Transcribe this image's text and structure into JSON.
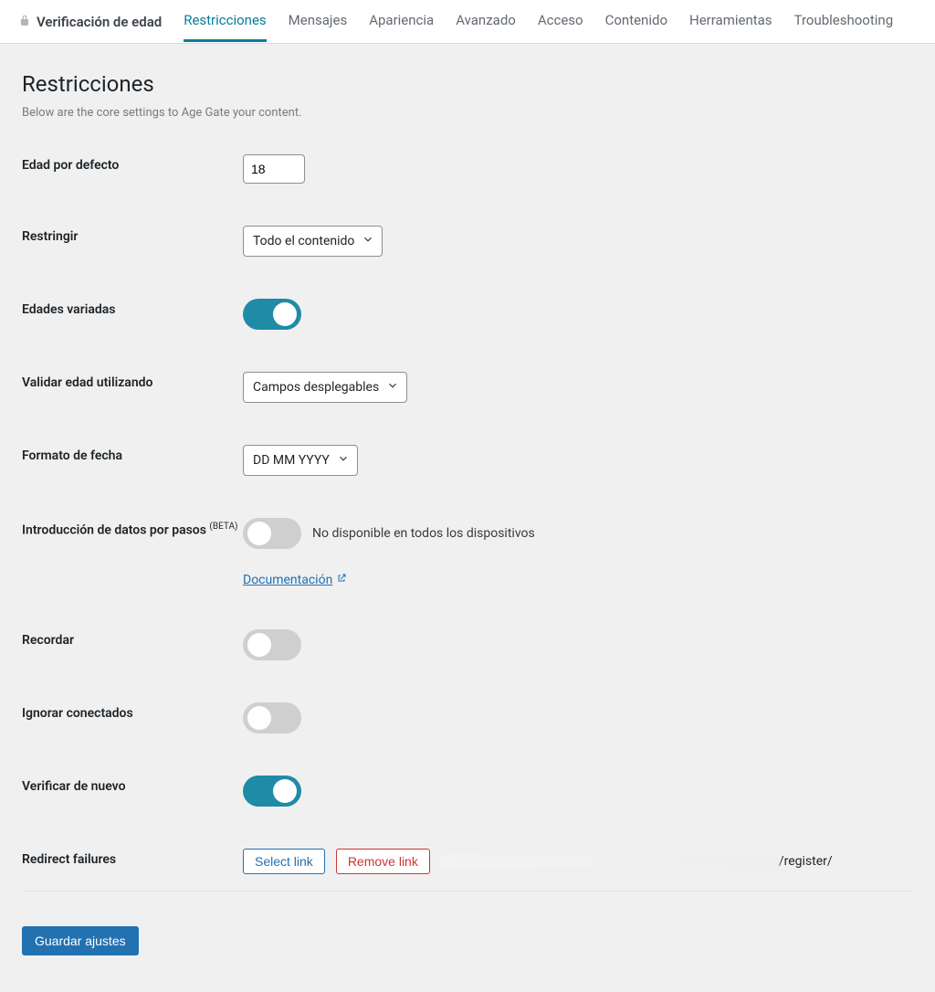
{
  "nav": {
    "title": "Verificación de edad",
    "tabs": [
      {
        "label": "Restricciones",
        "active": true
      },
      {
        "label": "Mensajes"
      },
      {
        "label": "Apariencia"
      },
      {
        "label": "Avanzado"
      },
      {
        "label": "Acceso"
      },
      {
        "label": "Contenido"
      },
      {
        "label": "Herramientas"
      },
      {
        "label": "Troubleshooting"
      }
    ]
  },
  "page": {
    "heading": "Restricciones",
    "description": "Below are the core settings to Age Gate your content."
  },
  "fields": {
    "default_age": {
      "label": "Edad por defecto",
      "value": "18"
    },
    "restrict": {
      "label": "Restringir",
      "value": "Todo el contenido"
    },
    "varied_ages": {
      "label": "Edades variadas",
      "on": true
    },
    "validate_using": {
      "label": "Validar edad utilizando",
      "value": "Campos desplegables"
    },
    "date_format": {
      "label": "Formato de fecha",
      "value": "DD MM YYYY"
    },
    "stepped": {
      "label": "Introducción de datos por pasos ",
      "beta": "(BETA)",
      "on": false,
      "note": "No disponible en todos los dispositivos",
      "doc": "Documentación"
    },
    "remember": {
      "label": "Recordar",
      "on": false
    },
    "ignore_logged": {
      "label": "Ignorar conectados",
      "on": false
    },
    "recheck": {
      "label": "Verificar de nuevo",
      "on": true
    },
    "redirect": {
      "label": "Redirect failures",
      "select_link": "Select link",
      "remove_link": "Remove link",
      "url_suffix": "/register/"
    }
  },
  "save_label": "Guardar ajustes"
}
